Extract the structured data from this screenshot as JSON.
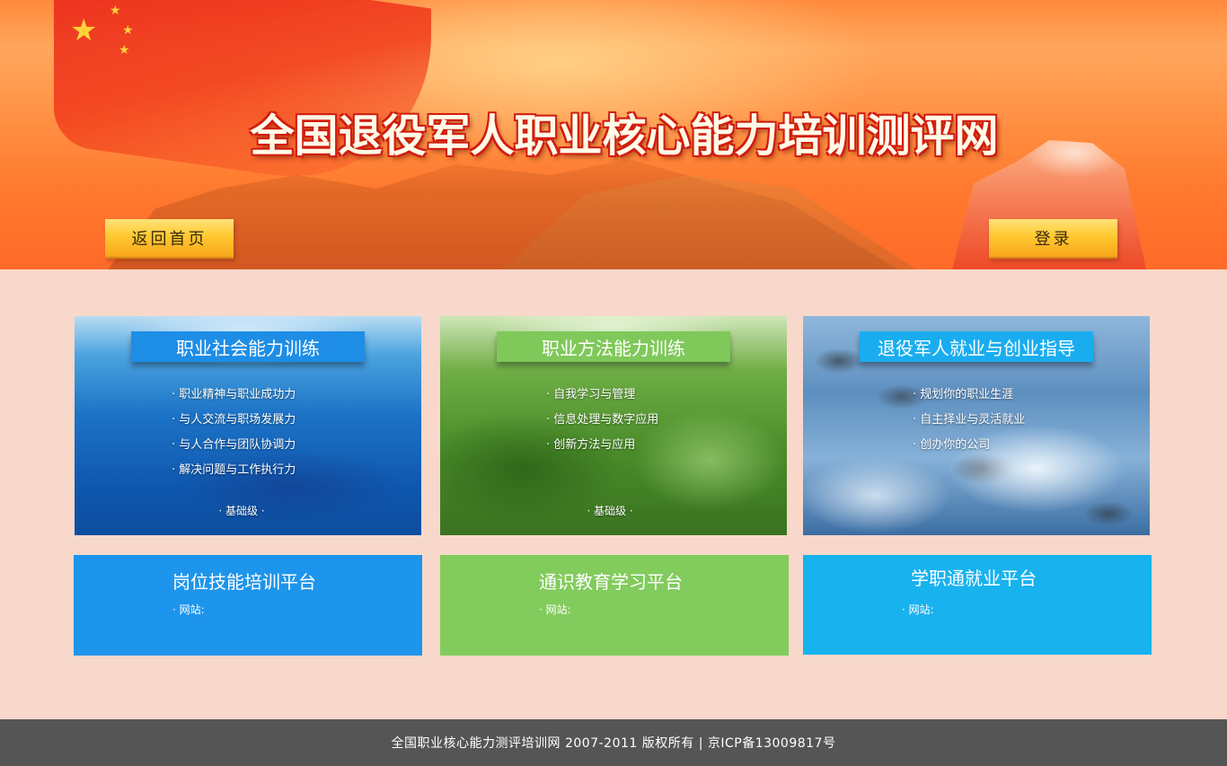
{
  "header": {
    "site_title": "全国退役军人职业核心能力培训测评网",
    "home_button": "返回首页",
    "login_button": "登录"
  },
  "cards": [
    {
      "title": "职业社会能力训练",
      "items": [
        "职业精神与职业成功力",
        "与人交流与职场发展力",
        "与人合作与团队协调力",
        "解决问题与工作执行力"
      ],
      "level": "· 基础级 ·"
    },
    {
      "title": "职业方法能力训练",
      "items": [
        "自我学习与管理",
        "信息处理与数字应用",
        "创新方法与应用"
      ],
      "level": "· 基础级 ·"
    },
    {
      "title": "退役军人就业与创业指导",
      "items": [
        "规划你的职业生涯",
        "自主择业与灵活就业",
        "创办你的公司"
      ]
    }
  ],
  "platforms": [
    {
      "title": "岗位技能培训平台",
      "site_label": "网站:"
    },
    {
      "title": "通识教育学习平台",
      "site_label": "网站:"
    },
    {
      "title": "学职通就业平台",
      "site_label": "网站:"
    }
  ],
  "footer": {
    "text": "全国职业核心能力测评培训网 2007-2011 版权所有 | 京ICP备13009817号"
  },
  "colors": {
    "page_bg": "#f8d8cb",
    "blue": "#1e95ec",
    "green": "#82cb5d",
    "cyan": "#18b2ee",
    "footer_bg": "#555555",
    "button_gold": "#ffc931"
  }
}
